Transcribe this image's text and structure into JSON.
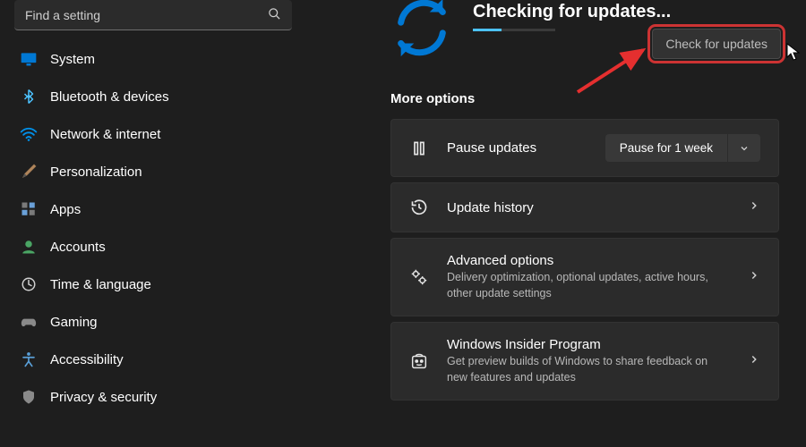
{
  "search": {
    "placeholder": "Find a setting"
  },
  "sidebar": {
    "items": [
      {
        "label": "System"
      },
      {
        "label": "Bluetooth & devices"
      },
      {
        "label": "Network & internet"
      },
      {
        "label": "Personalization"
      },
      {
        "label": "Apps"
      },
      {
        "label": "Accounts"
      },
      {
        "label": "Time & language"
      },
      {
        "label": "Gaming"
      },
      {
        "label": "Accessibility"
      },
      {
        "label": "Privacy & security"
      }
    ]
  },
  "status": {
    "title": "Checking for updates...",
    "check_button": "Check for updates"
  },
  "more_options_heading": "More options",
  "cards": {
    "pause": {
      "title": "Pause updates",
      "select_label": "Pause for 1 week"
    },
    "history": {
      "title": "Update history"
    },
    "advanced": {
      "title": "Advanced options",
      "desc": "Delivery optimization, optional updates, active hours, other update settings"
    },
    "insider": {
      "title": "Windows Insider Program",
      "desc": "Get preview builds of Windows to share feedback on new features and updates"
    }
  }
}
